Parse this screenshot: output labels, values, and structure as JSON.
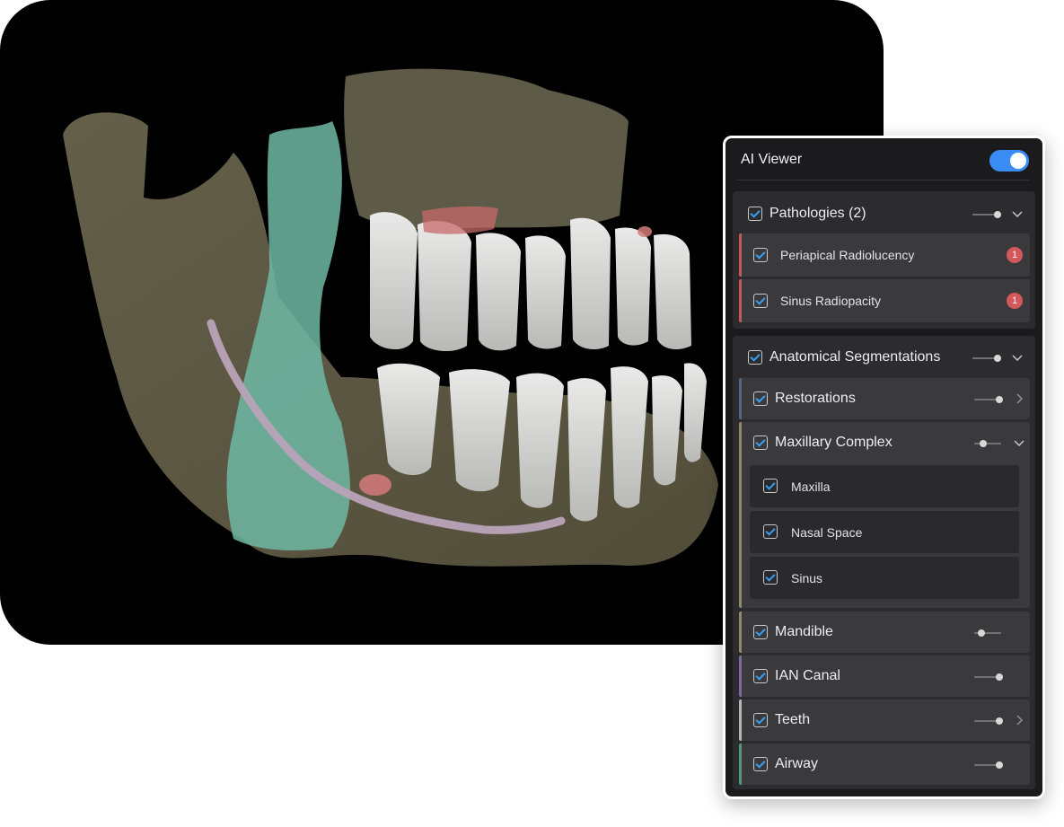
{
  "viewer": {
    "title": "AI Viewer",
    "enabled": true,
    "toggle_color": "#3a8df5"
  },
  "pathologies": {
    "label": "Pathologies (2)",
    "items": [
      {
        "label": "Periapical Radiolucency",
        "count": "1",
        "accent": "#c5595c"
      },
      {
        "label": "Sinus Radiopacity",
        "count": "1",
        "accent": "#c5595c"
      }
    ]
  },
  "segmentations": {
    "label": "Anatomical Segmentations",
    "items": [
      {
        "label": "Restorations",
        "accent": "#4f6a85",
        "level": 0.95
      },
      {
        "label": "Maxillary Complex",
        "accent": "#8e8a68",
        "level": 0.35,
        "children": [
          {
            "label": "Maxilla"
          },
          {
            "label": "Nasal Space"
          },
          {
            "label": "Sinus"
          }
        ]
      },
      {
        "label": "Mandible",
        "accent": "#8e8a68",
        "level": 0.3
      },
      {
        "label": "IAN Canal",
        "accent": "#7e6aa0",
        "level": 0.95
      },
      {
        "label": "Teeth",
        "accent": "#b6b6b6",
        "level": 0.95
      },
      {
        "label": "Airway",
        "accent": "#4f9a7c",
        "level": 0.95
      }
    ]
  }
}
